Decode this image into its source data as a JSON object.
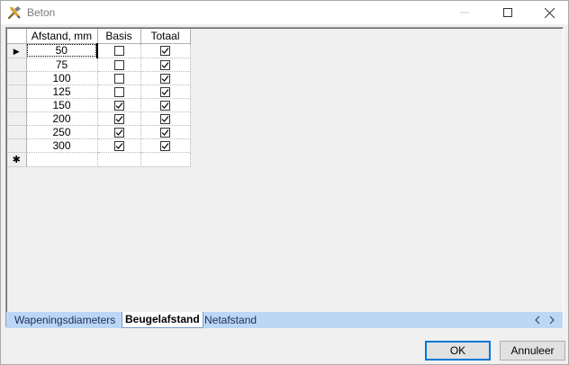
{
  "window": {
    "title": "Beton",
    "icon": "tools-icon"
  },
  "grid": {
    "columns": [
      "Afstand, mm",
      "Basis",
      "Totaal"
    ],
    "rows": [
      {
        "afstand": "50",
        "basis": false,
        "totaal": true
      },
      {
        "afstand": "75",
        "basis": false,
        "totaal": true
      },
      {
        "afstand": "100",
        "basis": false,
        "totaal": true
      },
      {
        "afstand": "125",
        "basis": false,
        "totaal": true
      },
      {
        "afstand": "150",
        "basis": true,
        "totaal": true
      },
      {
        "afstand": "200",
        "basis": true,
        "totaal": true
      },
      {
        "afstand": "250",
        "basis": true,
        "totaal": true
      },
      {
        "afstand": "300",
        "basis": true,
        "totaal": true
      }
    ],
    "current_row_marker": "▶",
    "new_row_marker": "✱"
  },
  "tabs": [
    {
      "label": "Wapeningsdiameters",
      "active": false
    },
    {
      "label": "Beugelafstand",
      "active": true
    },
    {
      "label": "Netafstand",
      "active": false
    }
  ],
  "buttons": {
    "ok": "OK",
    "cancel": "Annuleer"
  }
}
